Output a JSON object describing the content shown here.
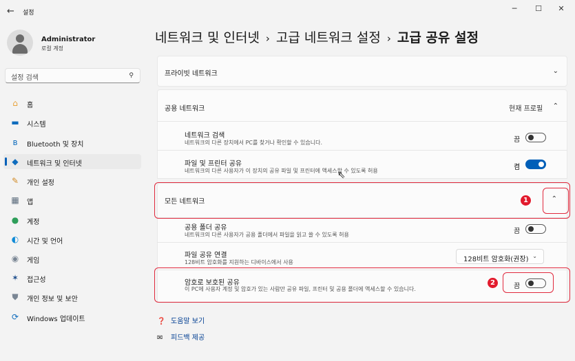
{
  "window": {
    "back_icon": "←",
    "title": "설정",
    "minimize": "─",
    "maximize": "☐",
    "close": "✕"
  },
  "profile": {
    "name": "Administrator",
    "account_type": "로컬 계정"
  },
  "search": {
    "placeholder": "설정 검색",
    "icon": "⚲"
  },
  "sidebar": {
    "items": [
      {
        "label": "홈",
        "icon": "home-icon",
        "glyph": "⌂",
        "color": "#e8a23a"
      },
      {
        "label": "시스템",
        "icon": "system-icon",
        "glyph": "▬",
        "color": "#0f6cbd"
      },
      {
        "label": "Bluetooth 및 장치",
        "icon": "bluetooth-icon",
        "glyph": "ʙ",
        "color": "#0f6cbd"
      },
      {
        "label": "네트워크 및 인터넷",
        "icon": "wifi-icon",
        "glyph": "◆",
        "color": "#0f6cbd"
      },
      {
        "label": "개인 설정",
        "icon": "brush-icon",
        "glyph": "✎",
        "color": "#d28b26"
      },
      {
        "label": "앱",
        "icon": "apps-icon",
        "glyph": "▦",
        "color": "#5b6b7c"
      },
      {
        "label": "계정",
        "icon": "account-icon",
        "glyph": "●",
        "color": "#2e9e5a"
      },
      {
        "label": "시간 및 언어",
        "icon": "globe-icon",
        "glyph": "◐",
        "color": "#0f8ad6"
      },
      {
        "label": "게임",
        "icon": "gamepad-icon",
        "glyph": "◉",
        "color": "#7a8694"
      },
      {
        "label": "접근성",
        "icon": "accessibility-icon",
        "glyph": "✶",
        "color": "#1a4a8a"
      },
      {
        "label": "개인 정보 및 보안",
        "icon": "shield-icon",
        "glyph": "⛊",
        "color": "#7a8694"
      },
      {
        "label": "Windows 업데이트",
        "icon": "update-icon",
        "glyph": "⟳",
        "color": "#0f6cbd"
      }
    ],
    "active_index": 3
  },
  "breadcrumb": {
    "part1": "네트워크 및 인터넷",
    "part2": "고급 네트워크 설정",
    "current": "고급 공유 설정",
    "separator": "›"
  },
  "sections": {
    "private": {
      "title": "프라이빗 네트워크",
      "chevron": "⌄"
    },
    "public": {
      "title": "공용 네트워크",
      "status": "현재 프로필",
      "chevron": "⌃",
      "network_discovery": {
        "title": "네트워크 검색",
        "desc": "네트워크의 다른 장치에서 PC를 찾거나 확인할 수 있습니다.",
        "state": "끔"
      },
      "file_printer_sharing": {
        "title": "파일 및 프린터 공유",
        "desc": "네트워크의 다른 사용자가 이 장치의 공유 파일 및 프린터에 액세스할 수 있도록 허용",
        "state": "켬"
      }
    },
    "all": {
      "title": "모든 네트워크",
      "chevron": "⌃",
      "public_folder": {
        "title": "공용 폴더 공유",
        "desc": "네트워크의 다른 사용자가 공용 폴더에서 파일을 읽고 쓸 수 있도록 허용",
        "state": "끔"
      },
      "file_sharing_connection": {
        "title": "파일 공유 연결",
        "desc": "128비트 암호화를 지원하는 디바이스에서 사용",
        "selected": "128비트 암호화(권장)",
        "chevron": "⌄"
      },
      "password_protected": {
        "title": "암호로 보호된 공유",
        "desc": "이 PC에 사용자 계정 및 암호가 있는 사람만 공유 파일, 프린터 및 공용 폴더에 액세스할 수 있습니다.",
        "state": "끔"
      }
    }
  },
  "annotations": {
    "badge1": "1",
    "badge2": "2",
    "color": "#e0283c"
  },
  "footer": {
    "help": "도움말 보기",
    "help_icon": "❓",
    "feedback": "피드백 제공",
    "feedback_icon": "✉"
  },
  "colors": {
    "accent": "#005fb8",
    "background": "#f3f3f3",
    "card": "#fbfbfb"
  }
}
